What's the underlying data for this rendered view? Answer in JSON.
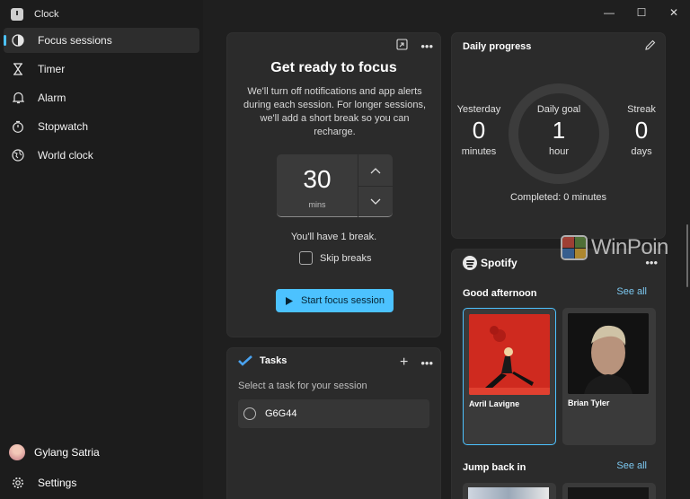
{
  "app": {
    "title": "Clock"
  },
  "window_controls": {
    "minimize": "—",
    "maximize": "☐",
    "close": "✕"
  },
  "sidebar": {
    "items": [
      {
        "label": "Focus sessions",
        "icon": "focus-icon",
        "active": true
      },
      {
        "label": "Timer",
        "icon": "hourglass-icon"
      },
      {
        "label": "Alarm",
        "icon": "bell-icon"
      },
      {
        "label": "Stopwatch",
        "icon": "stopwatch-icon"
      },
      {
        "label": "World clock",
        "icon": "globe-icon"
      }
    ],
    "user": "Gylang Satria",
    "settings": "Settings"
  },
  "focus": {
    "title": "Get ready to focus",
    "description": "We'll turn off notifications and app alerts during each session. For longer sessions, we'll add a short break so you can recharge.",
    "minutes": "30",
    "unit": "mins",
    "break_text": "You'll have 1 break.",
    "skip_label": "Skip breaks",
    "start_label": "Start focus session"
  },
  "tasks": {
    "title": "Tasks",
    "hint": "Select a task for your session",
    "items": [
      "G6G44"
    ]
  },
  "progress": {
    "title": "Daily progress",
    "yesterday": {
      "label": "Yesterday",
      "value": "0",
      "unit": "minutes"
    },
    "goal": {
      "label": "Daily goal",
      "value": "1",
      "unit": "hour"
    },
    "streak": {
      "label": "Streak",
      "value": "0",
      "unit": "days"
    },
    "completed": "Completed: 0 minutes"
  },
  "spotify": {
    "brand": "Spotify",
    "section1": "Good afternoon",
    "see_all": "See all",
    "tiles": [
      "Avril Lavigne",
      "Brian Tyler"
    ],
    "section2": "Jump back in"
  },
  "watermark": "WinPoin",
  "colors": {
    "accent": "#4cc2ff",
    "background": "#1f1f1f",
    "card": "#2b2b2b"
  }
}
